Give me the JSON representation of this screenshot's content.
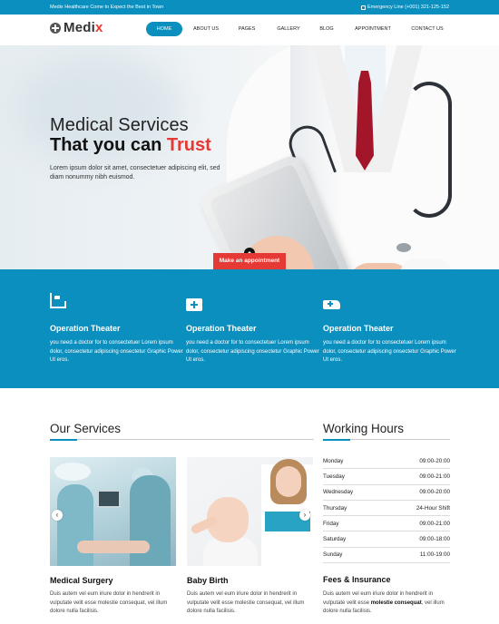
{
  "topbar": {
    "tagline": "Medix Healthcare Come to Expect the Best in Town",
    "emergency_label": "Emergency Line (+001) 321-125-152"
  },
  "header": {
    "logo_prefix": "Medi",
    "logo_accent": "x",
    "nav": [
      {
        "label": "HOME",
        "active": true
      },
      {
        "label": "ABOUT US",
        "active": false
      },
      {
        "label": "PAGES",
        "active": false
      },
      {
        "label": "GALLERY",
        "active": false
      },
      {
        "label": "BLOG",
        "active": false
      },
      {
        "label": "APPOINTMENT",
        "active": false
      },
      {
        "label": "CONTACT US",
        "active": false
      }
    ]
  },
  "hero": {
    "title_line1": "Medical Services",
    "title_line2_prefix": "That you can ",
    "title_line2_accent": "Trust",
    "description": "Lorem ipsum dolor sit amet, consectetuer adipiscing elit, sed diam nonummy nibh euismod.",
    "cta_label": "Make an appointment"
  },
  "features": [
    {
      "icon": "hospital-bed-icon",
      "title": "Operation Theater",
      "text": "you need a doctor for to consectetuer Lorem ipsum dolor, consectetur adipiscing onsectetur Graphic Power Ut eros."
    },
    {
      "icon": "medical-kit-icon",
      "title": "Operation Theater",
      "text": "you need a doctor for to consectetuer Lorem ipsum dolor, consectetur adipiscing onsectetur Graphic Power Ut eros."
    },
    {
      "icon": "ambulance-icon",
      "title": "Operation Theater",
      "text": "you need a doctor for to consectetuer Lorem ipsum dolor, consectetur adipiscing onsectetur Graphic Power Ut eros."
    }
  ],
  "services": {
    "title": "Our Services",
    "cards": [
      {
        "title": "Medical Surgery",
        "text": "Duis autem vel eum iriure dolor in hendrerit in vulputate velit esse molestie consequat, vel illum dolore nulla facilisis."
      },
      {
        "title": "Baby Birth",
        "text": "Duis autem vel eum iriure dolor in hendrerit in vulputate velit esse molestie consequat, vel illum dolore nulla facilisis."
      }
    ],
    "prev_glyph": "‹",
    "next_glyph": "›"
  },
  "hours": {
    "title": "Working Hours",
    "rows": [
      {
        "day": "Monday",
        "time": "09:00-20:00"
      },
      {
        "day": "Tuesday",
        "time": "09:00-21:00"
      },
      {
        "day": "Wednesday",
        "time": "09:00-20:00"
      },
      {
        "day": "Thursday",
        "time": "24-Hour Shift"
      },
      {
        "day": "Friday",
        "time": "09:00-21:00"
      },
      {
        "day": "Saturday",
        "time": "09:00-18:00"
      },
      {
        "day": "Sunday",
        "time": "11:00-19:00"
      }
    ]
  },
  "fees": {
    "title": "Fees & Insurance",
    "text_before": "Duis autem vel eum iriure dolor in hendrerit in vulputate velit esse ",
    "text_bold": "molestie consequat",
    "text_after": ", vel illum dolore nulla facilisis."
  },
  "colors": {
    "accent": "#0a8fbf",
    "highlight": "#e53935"
  }
}
